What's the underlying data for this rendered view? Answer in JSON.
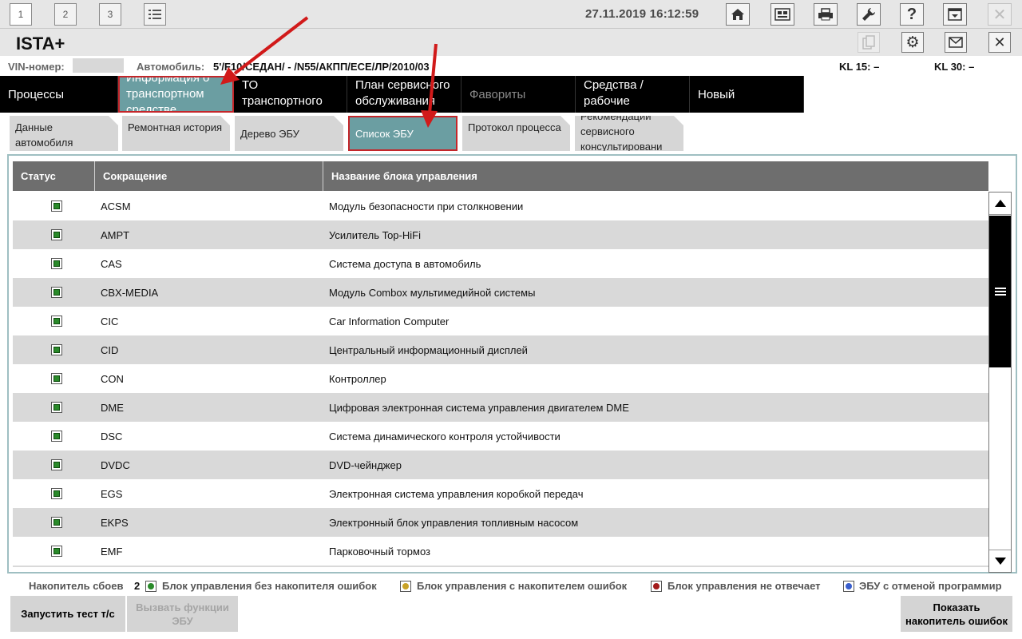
{
  "toolbar": {
    "tabs": [
      "1",
      "2",
      "3"
    ],
    "datetime": "27.11.2019 16:12:59"
  },
  "title": {
    "app": "ISTA+"
  },
  "vehicle": {
    "vin_label": "VIN-номер:",
    "car_label": "Автомобиль:",
    "car_value": "5'/F10/СЕДАН/ - /N55/АКПП/ЕСЕ/ЛР/2010/03",
    "kl15": "KL 15:  –",
    "kl30": "KL 30:  –"
  },
  "main_nav": [
    {
      "label": "Процессы"
    },
    {
      "label": "Информация о транспортном средстве"
    },
    {
      "label": "ТО транспортного средства"
    },
    {
      "label": "План сервисного обслуживания"
    },
    {
      "label": "Фавориты"
    },
    {
      "label": "Средства / рабочие жидкости"
    },
    {
      "label": "Новый"
    }
  ],
  "sub_tabs": [
    {
      "label": "Данные автомобиля"
    },
    {
      "label": "Ремонтная история"
    },
    {
      "label": "Дерево ЭБУ"
    },
    {
      "label": "Список ЭБУ"
    },
    {
      "label": "Протокол процесса"
    },
    {
      "label": "Рекомендации сервисного консультировани"
    }
  ],
  "table": {
    "headers": [
      "Статус",
      "Сокращение",
      "Название блока управления"
    ],
    "rows": [
      {
        "abbr": "ACSM",
        "name": "Модуль безопасности при столкновении"
      },
      {
        "abbr": "AMPT",
        "name": "Усилитель Top-HiFi"
      },
      {
        "abbr": "CAS",
        "name": "Система доступа в автомобиль"
      },
      {
        "abbr": "CBX-MEDIA",
        "name": "Модуль Combox мультимедийной системы"
      },
      {
        "abbr": "CIC",
        "name": "Car Information Computer"
      },
      {
        "abbr": "CID",
        "name": "Центральный информационный дисплей"
      },
      {
        "abbr": "CON",
        "name": "Контроллер"
      },
      {
        "abbr": "DME",
        "name": "Цифровая электронная система управления двигателем DME"
      },
      {
        "abbr": "DSC",
        "name": "Система динамического контроля устойчивости"
      },
      {
        "abbr": "DVDC",
        "name": "DVD-чейнджер"
      },
      {
        "abbr": "EGS",
        "name": "Электронная система управления коробкой передач"
      },
      {
        "abbr": "EKPS",
        "name": "Электронный блок управления топливным насосом"
      },
      {
        "abbr": "EMF",
        "name": "Парковочный тормоз"
      }
    ]
  },
  "legend": {
    "fault_label": "Накопитель сбоев",
    "fault_count": "2",
    "items": [
      {
        "label": "Блок управления без накопителя ошибок",
        "color": "#2a8a2a"
      },
      {
        "label": "Блок управления с накопителем ошибок",
        "color": "#c9a227"
      },
      {
        "label": "Блок управления не отвечает",
        "color": "#a31c1c"
      },
      {
        "label": "ЭБУ с отменой программир",
        "color": "#3a5fcd"
      }
    ]
  },
  "buttons": {
    "run_test": "Запустить тест т/с",
    "call_functions": "Вызвать функции ЭБУ",
    "show_fault_memory": "Показать накопитель ошибок"
  },
  "colors": {
    "accent_teal": "#6b9ea2",
    "annotation_red": "#d11a1a"
  }
}
